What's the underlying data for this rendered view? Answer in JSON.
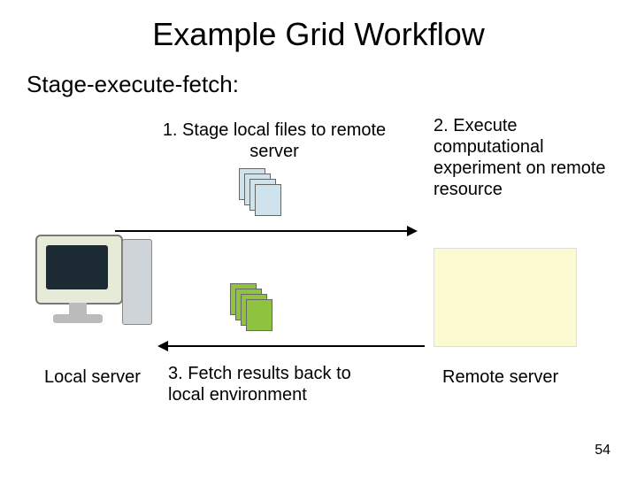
{
  "title": "Example Grid Workflow",
  "subtitle": "Stage-execute-fetch:",
  "steps": {
    "s1": "1. Stage local files to remote server",
    "s2": "2. Execute computational experiment on remote resource",
    "s3": "3. Fetch results back to local environment"
  },
  "labels": {
    "local": "Local server",
    "remote": "Remote server"
  },
  "page_number": "54"
}
